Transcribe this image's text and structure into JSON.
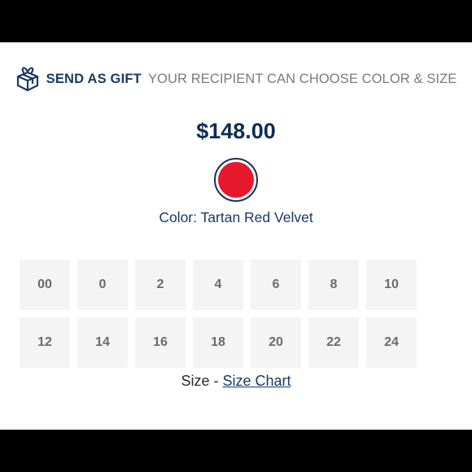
{
  "gift": {
    "icon": "gift-box-icon",
    "strong_text": "SEND AS GIFT",
    "light_text": "YOUR RECIPIENT CAN CHOOSE COLOR & SIZE"
  },
  "product": {
    "price": "$148.00",
    "color_label": "Color: Tartan Red Velvet",
    "swatch_color": "#e8182c",
    "swatch_border_color": "#1b2f52"
  },
  "sizes": [
    "00",
    "0",
    "2",
    "4",
    "6",
    "8",
    "10",
    "12",
    "14",
    "16",
    "18",
    "20",
    "22",
    "24"
  ],
  "size_caption": {
    "prefix": "Size - ",
    "link": "Size Chart"
  },
  "colors": {
    "navy": "#1b3a63",
    "tile_bg": "#f4f4f4",
    "tile_text": "#6b6b6b"
  }
}
